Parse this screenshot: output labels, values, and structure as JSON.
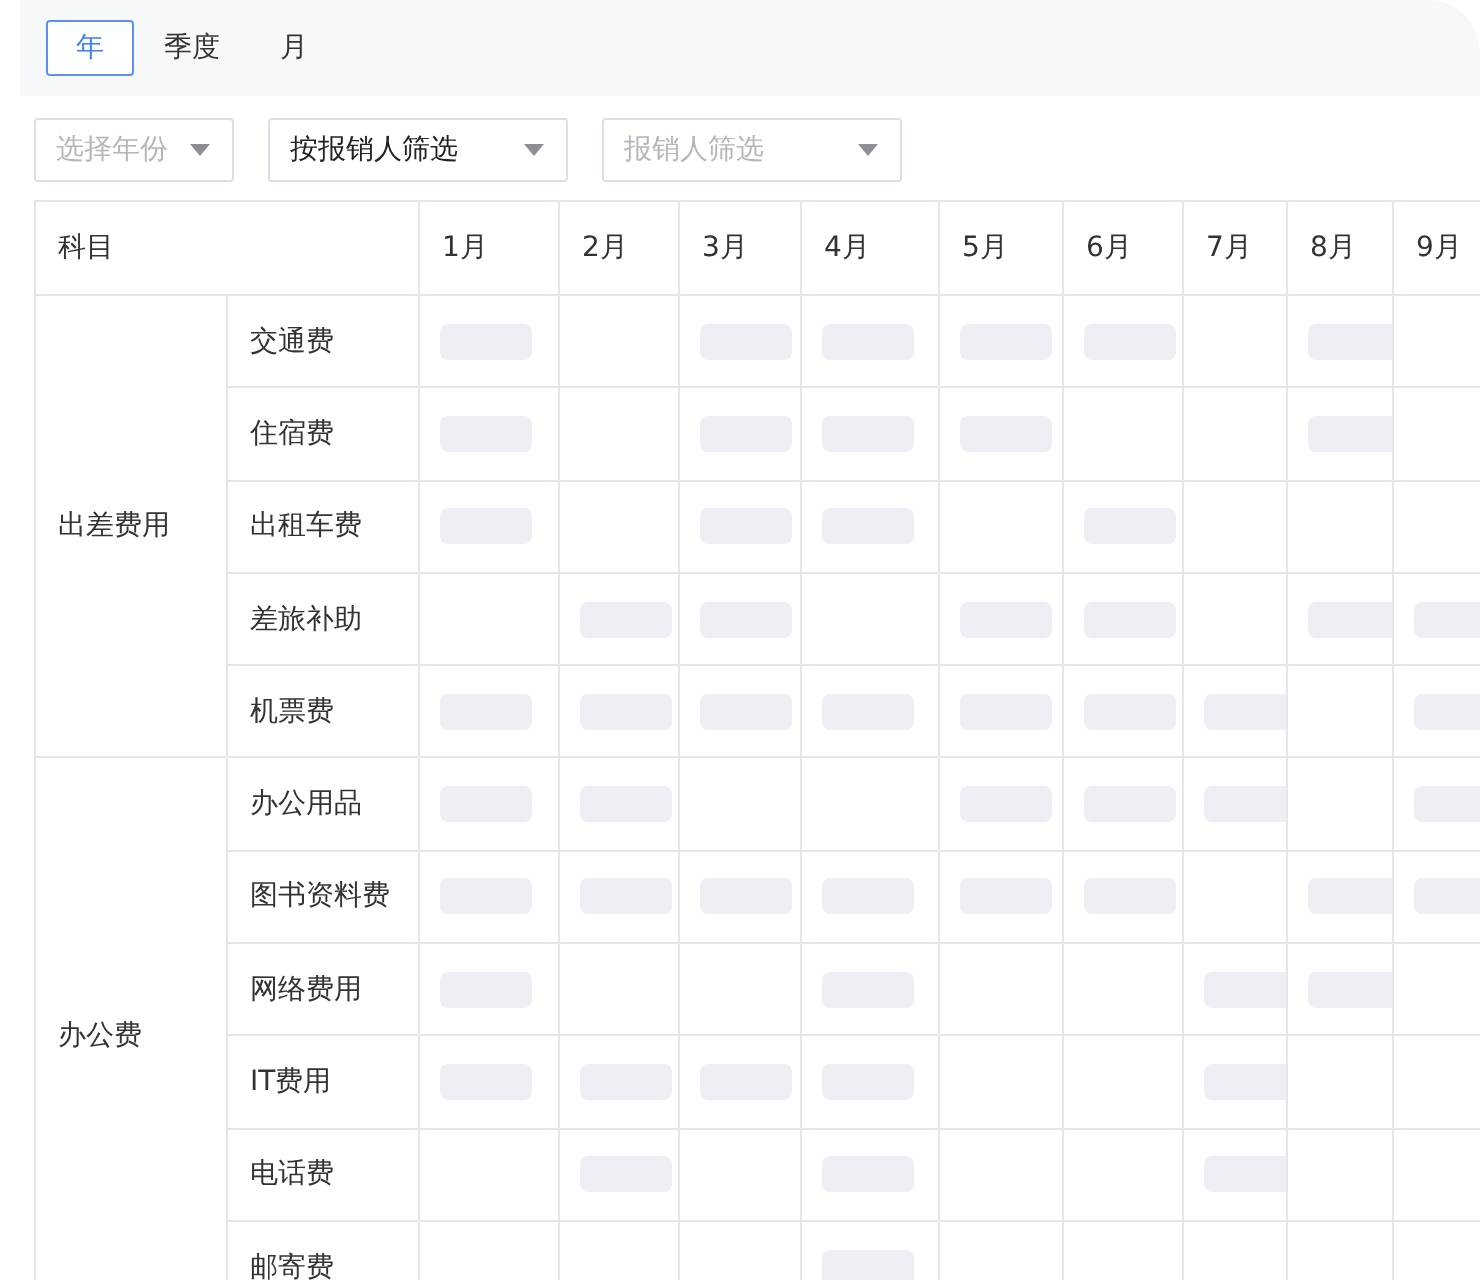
{
  "tabs": [
    {
      "label": "年",
      "selected": true
    },
    {
      "label": "季度",
      "selected": false
    },
    {
      "label": "月",
      "selected": false
    }
  ],
  "filters": [
    {
      "placeholder": "选择年份"
    },
    {
      "value": "按报销人筛选"
    },
    {
      "placeholder": "报销人筛选"
    }
  ],
  "table": {
    "columns": [
      "科目",
      "1月",
      "2月",
      "3月",
      "4月",
      "5月",
      "6月",
      "7月",
      "8月",
      "9月"
    ],
    "groups": [
      {
        "name": "出差费用",
        "items": [
          {
            "name": "交通费",
            "loading": [
              true,
              false,
              true,
              true,
              true,
              true,
              false,
              true,
              false
            ]
          },
          {
            "name": "住宿费",
            "loading": [
              true,
              false,
              true,
              true,
              true,
              false,
              false,
              true,
              false
            ]
          },
          {
            "name": "出租车费",
            "loading": [
              true,
              false,
              true,
              true,
              false,
              true,
              false,
              false,
              false
            ]
          },
          {
            "name": "差旅补助",
            "loading": [
              false,
              true,
              true,
              false,
              true,
              true,
              false,
              true,
              true
            ]
          },
          {
            "name": "机票费",
            "loading": [
              true,
              true,
              true,
              true,
              true,
              true,
              true,
              false,
              true
            ]
          }
        ]
      },
      {
        "name": "办公费",
        "items": [
          {
            "name": "办公用品",
            "loading": [
              true,
              true,
              false,
              false,
              true,
              true,
              true,
              false,
              true
            ]
          },
          {
            "name": "图书资料费",
            "loading": [
              true,
              true,
              true,
              true,
              true,
              true,
              false,
              true,
              true
            ]
          },
          {
            "name": "网络费用",
            "loading": [
              true,
              false,
              false,
              true,
              false,
              false,
              true,
              true,
              false
            ]
          },
          {
            "name": "IT费用",
            "loading": [
              true,
              true,
              true,
              true,
              false,
              false,
              true,
              false,
              false
            ]
          },
          {
            "name": "电话费",
            "loading": [
              false,
              true,
              false,
              true,
              false,
              false,
              true,
              false,
              false
            ]
          },
          {
            "name": "邮寄费",
            "loading": [
              false,
              false,
              false,
              true,
              false,
              false,
              false,
              false,
              false
            ]
          }
        ]
      }
    ]
  }
}
